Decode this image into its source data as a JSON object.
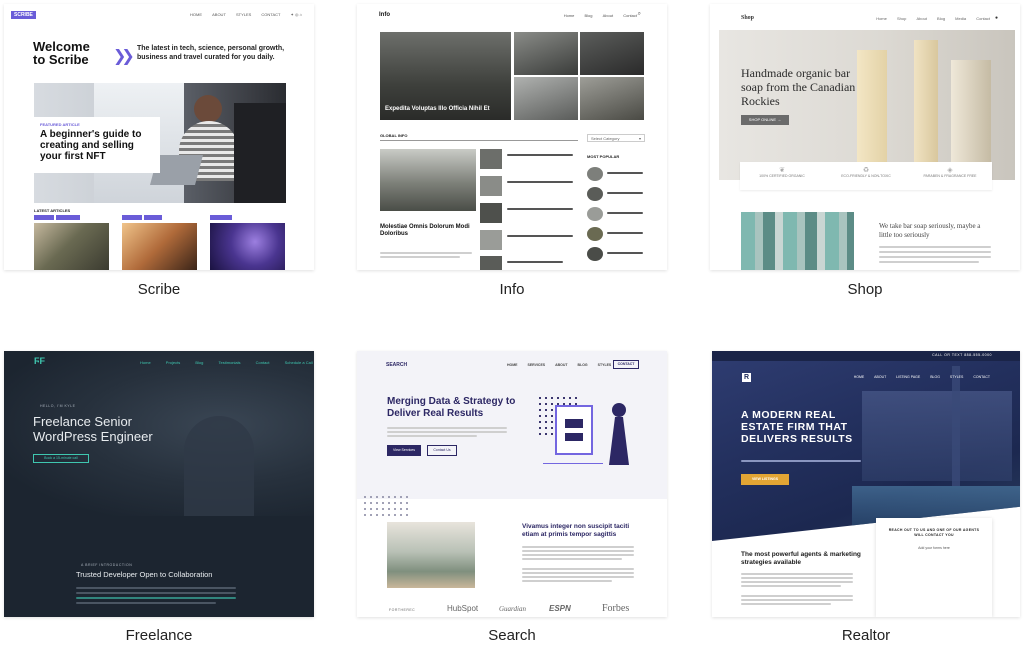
{
  "cards": [
    {
      "caption": "Scribe",
      "logo": "SCRIBE",
      "nav": [
        "HOME",
        "ABOUT",
        "STYLES",
        "CONTACT"
      ],
      "headline": "Welcome to Scribe",
      "tagline": "The latest in tech, science, personal growth, business and travel curated for you daily.",
      "featured_label": "FEATURED ARTICLE",
      "featured_title": "A beginner's guide to creating and selling your first NFT",
      "latest_label": "LATEST ARTICLES"
    },
    {
      "caption": "Info",
      "logo": "Info",
      "nav": [
        "Home",
        "Blog",
        "About",
        "Contact"
      ],
      "hero_title": "Expedita Voluptas Illo Officia Nihil Et",
      "global_label": "GLOBAL INFO",
      "category_select": "Select Category",
      "article_title": "Molestiae Omnis Dolorum Modi Doloribus",
      "popular_label": "MOST POPULAR"
    },
    {
      "caption": "Shop",
      "logo": "Shop",
      "nav": [
        "Home",
        "Shop",
        "About",
        "Blog",
        "Media",
        "Contact"
      ],
      "hero_title": "Handmade organic bar soap from the Canadian Rockies",
      "hero_button": "SHOP ONLINE →",
      "features": [
        "100% CERTIFIED ORGANIC",
        "ECO-FRIENDLY & NON-TOXIC",
        "PARABEN & FRAGRANCE FREE"
      ],
      "about_title": "We take bar soap seriously, maybe a little too seriously"
    },
    {
      "caption": "Freelance",
      "nav": [
        "Home",
        "Projects",
        "Blog",
        "Testimonials",
        "Contact",
        "Schedule a Call"
      ],
      "kicker": "HELLO, I'M KYLE",
      "headline": "Freelance Senior WordPress Engineer",
      "button": "Book a 15-minute call",
      "intro_kicker": "A BRIEF INTRODUCTION",
      "intro_title": "Trusted Developer Open to Collaboration"
    },
    {
      "caption": "Search",
      "logo": "SEARCH",
      "nav": [
        "HOME",
        "SERVICES",
        "ABOUT",
        "BLOG",
        "STYLES"
      ],
      "nav_button": "CONTACT",
      "headline": "Merging Data & Strategy to Deliver Real Results",
      "primary_button": "View Services",
      "secondary_button": "Contact Us",
      "section_title": "Vivamus integer non suscipit taciti etiam at primis tempor sagittis",
      "logos": [
        "FORTHEREC",
        "HubSpot",
        "Guardian",
        "ESPN",
        "Forbes"
      ]
    },
    {
      "caption": "Realtor",
      "topbar": "CALL OR TEXT 888-555-0000",
      "nav": [
        "HOME",
        "ABOUT",
        "LISTING PAGE",
        "BLOG",
        "STYLES",
        "CONTACT"
      ],
      "headline": "A MODERN REAL ESTATE FIRM THAT DELIVERS RESULTS",
      "button": "VIEW LISTINGS",
      "agents_title": "The most powerful agents & marketing strategies available",
      "contact_title": "REACH OUT TO US AND ONE OF OUR AGENTS WILL CONTACT YOU",
      "contact_field": "Add your forms here"
    }
  ],
  "colors": {
    "accent_purple": "#6a5cd8",
    "freelance_bg": "#1c2530",
    "freelance_teal": "#3fc7b0",
    "realtor_navy": "#22305e",
    "realtor_gold": "#e2a534",
    "search_navy": "#2c2764"
  }
}
